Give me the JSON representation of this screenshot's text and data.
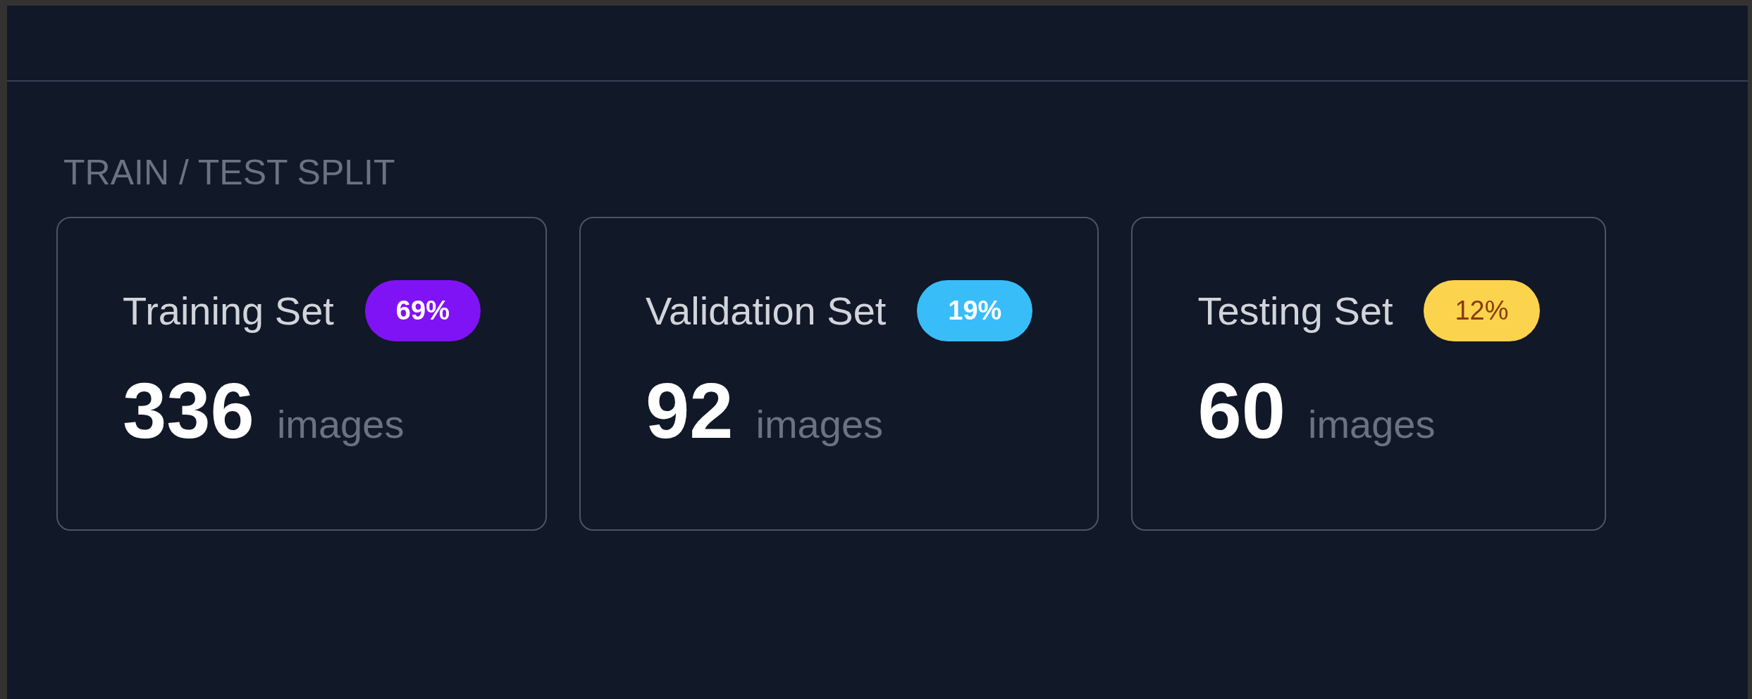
{
  "section_title": "TRAIN / TEST SPLIT",
  "sets": [
    {
      "name": "Training Set",
      "percent": "69%",
      "color": "#7f13f5",
      "count": "336",
      "unit": "images"
    },
    {
      "name": "Validation Set",
      "percent": "19%",
      "color": "#38bdf8",
      "count": "92",
      "unit": "images"
    },
    {
      "name": "Testing Set",
      "percent": "12%",
      "color": "#fcd34d",
      "count": "60",
      "unit": "images"
    }
  ]
}
